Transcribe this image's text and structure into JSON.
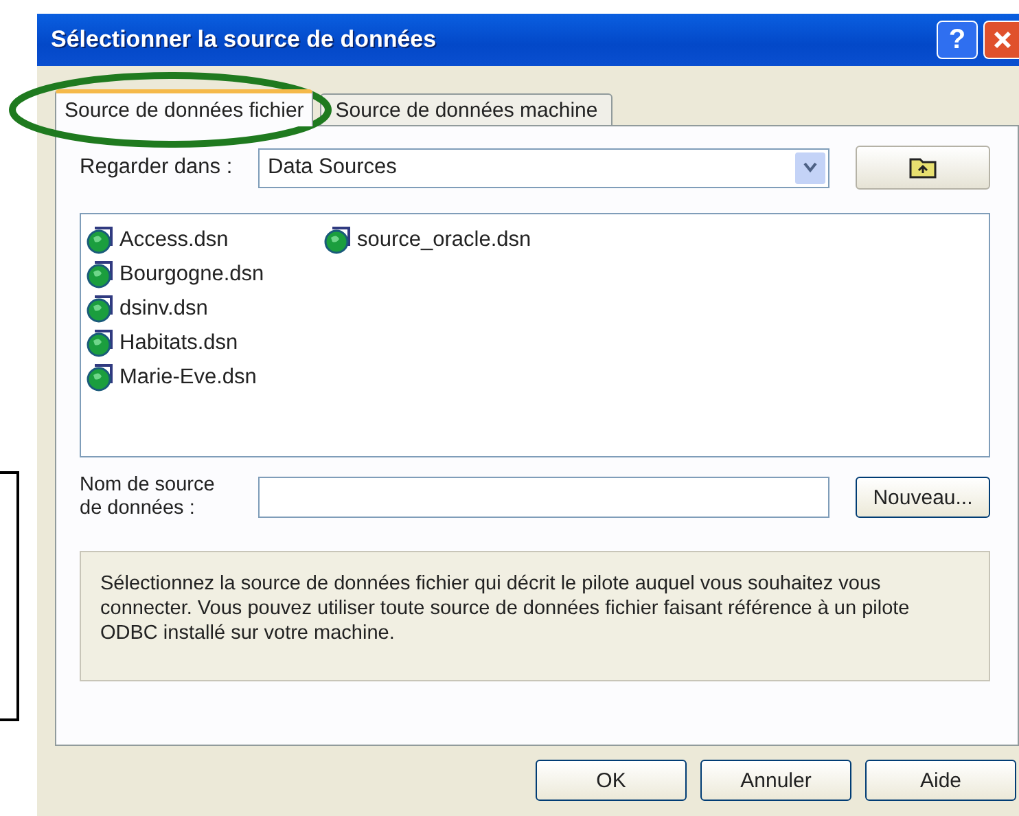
{
  "window": {
    "title": "Sélectionner la source de données",
    "help": "?"
  },
  "tabs": [
    {
      "label": "Source de données fichier",
      "selected": true
    },
    {
      "label": "Source de données machine",
      "selected": false
    }
  ],
  "look_in": {
    "label": "Regarder dans :",
    "value": "Data Sources"
  },
  "files": [
    {
      "name": "Access.dsn"
    },
    {
      "name": "Bourgogne.dsn"
    },
    {
      "name": "dsinv.dsn"
    },
    {
      "name": "Habitats.dsn"
    },
    {
      "name": "Marie-Eve.dsn"
    },
    {
      "name": "source_oracle.dsn"
    }
  ],
  "name_field": {
    "label": "Nom de source de données :",
    "button": "Nouveau..."
  },
  "description": "Sélectionnez la source de données fichier qui décrit le pilote auquel vous souhaitez vous connecter. Vous pouvez utiliser toute source de données fichier faisant référence à un pilote ODBC installé sur votre machine.",
  "buttons": [
    "OK",
    "Annuler",
    "Aide"
  ]
}
